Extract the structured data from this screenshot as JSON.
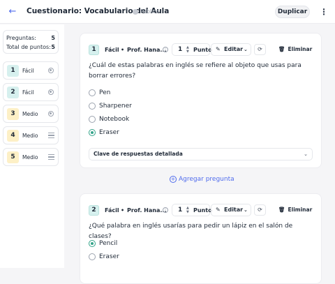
{
  "header": {
    "title": "Cuestionario: Vocabulario del Aula",
    "visibility": "Público",
    "duplicate_label": "Duplicar"
  },
  "sidebar": {
    "stats": [
      {
        "label": "Preguntas:",
        "value": "5"
      },
      {
        "label": "Total de puntos:",
        "value": "5"
      }
    ],
    "items": [
      {
        "num": "1",
        "difficulty": "Fácil",
        "color": "#d6f0ee",
        "icon": "radio-icon"
      },
      {
        "num": "2",
        "difficulty": "Fácil",
        "color": "#d6f0ee",
        "icon": "radio-icon"
      },
      {
        "num": "3",
        "difficulty": "Medio",
        "color": "#fdf0c6",
        "icon": "radio-icon"
      },
      {
        "num": "4",
        "difficulty": "Medio",
        "color": "#fdf0c6",
        "icon": "text-lines-icon"
      },
      {
        "num": "5",
        "difficulty": "Medio",
        "color": "#fdf0c6",
        "icon": "text-lines-icon"
      }
    ]
  },
  "questions": [
    {
      "num": "1",
      "difficulty": "Fácil",
      "author": "Prof. Hana...",
      "points": "1",
      "points_unit": "Punto",
      "edit_label": "Editar",
      "delete_label": "Eliminar",
      "text": "¿Cuál de estas palabras en inglés se refiere al objeto que usas para borrar errores?",
      "options": [
        {
          "label": "Pen",
          "selected": false
        },
        {
          "label": "Sharpener",
          "selected": false
        },
        {
          "label": "Notebook",
          "selected": false
        },
        {
          "label": "Eraser",
          "selected": true
        }
      ],
      "answer_key_label": "Clave de respuestas detallada"
    },
    {
      "num": "2",
      "difficulty": "Fácil",
      "author": "Prof. Hana...",
      "points": "1",
      "points_unit": "Punto",
      "edit_label": "Editar",
      "delete_label": "Eliminar",
      "text": "¿Qué palabra en inglés usarías para pedir un lápiz en el salón de clases?",
      "options": [
        {
          "label": "Pencil",
          "selected": true
        },
        {
          "label": "Eraser",
          "selected": false
        }
      ]
    }
  ],
  "add_question_label": "Agregar pregunta",
  "colors": {
    "accent": "#4f6bed",
    "correct": "#34a48a"
  }
}
